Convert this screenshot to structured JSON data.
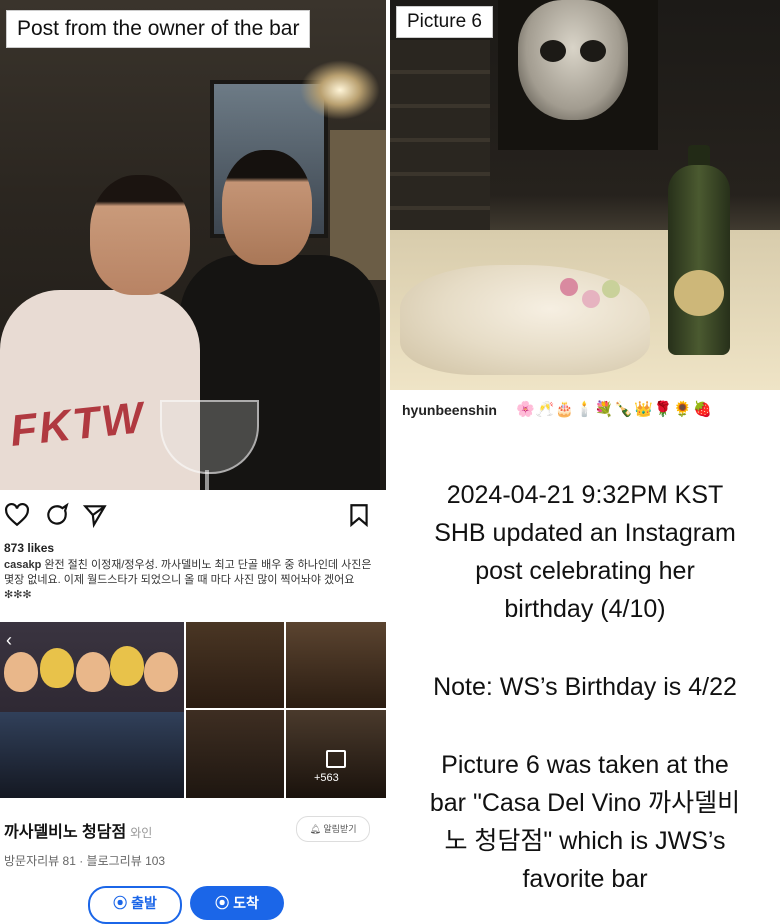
{
  "left": {
    "caption": "Post from the owner of the bar",
    "shirt_text": "FKTW",
    "instagram": {
      "likes": "873 likes",
      "username": "casakp",
      "caption": "완전 절친 이정재/정우성. 까사델비노 최고 단골 배우 중 하나인데 사진은 몇장 없네요. 이제 월드스타가 되었으니 올 때 마다 사진 많이 찍어놔야 겠어요 ✻✻✻",
      "icons": [
        "heart-icon",
        "comment-icon",
        "share-icon",
        "bookmark-icon"
      ]
    },
    "listing": {
      "photo_count": "+563",
      "name": "까사델비노 청담점",
      "category": "와인",
      "reviews": "방문자리뷰 81 · 블로그리뷰 103",
      "alarm_label": "알림받기",
      "start_label": "출발",
      "arrive_label": "도착"
    }
  },
  "right": {
    "caption": "Picture 6",
    "handle": "hyunbeenshin",
    "emojis": "🌸🥂🎂🕯️💐🍾👑🌹🌻🍓",
    "line1": "2024-04-21 9:32PM KST",
    "line2": "SHB updated an Instagram",
    "line3": "post celebrating her",
    "line4": "birthday (4/10)",
    "note": "Note: WS’s Birthday is 4/22",
    "p1": "Picture 6 was taken at the",
    "p2": "bar \"Casa Del Vino 까사델비",
    "p3": "노 청담점\" which is JWS’s",
    "p4": "favorite bar"
  }
}
